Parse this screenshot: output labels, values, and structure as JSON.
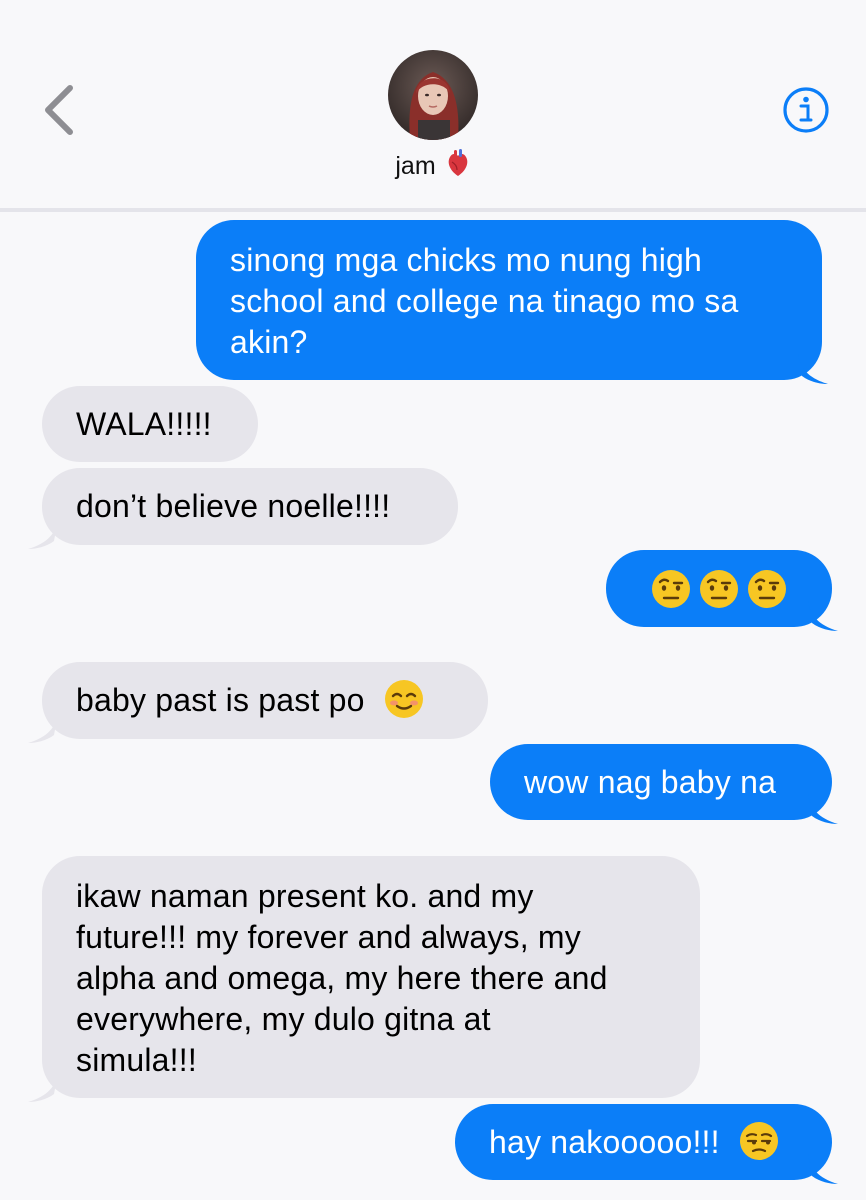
{
  "header": {
    "back_icon": "chevron-left-icon",
    "contact_name": "jam",
    "contact_emoji": "anatomical-heart",
    "info_icon": "info-icon"
  },
  "colors": {
    "sent_bubble": "#0b7ef8",
    "received_bubble": "#e6e5eb",
    "accent": "#0b7ef8",
    "background": "#f8f8fa"
  },
  "messages": [
    {
      "direction": "sent",
      "text": "sinong mga chicks mo nung high\nschool and college na tinago mo sa\nakin?"
    },
    {
      "direction": "received",
      "text": "WALA!!!!!"
    },
    {
      "direction": "received",
      "text": "don’t believe noelle!!!!"
    },
    {
      "direction": "sent",
      "text": "",
      "emojis": [
        "face-with-raised-eyebrow",
        "face-with-raised-eyebrow",
        "face-with-raised-eyebrow"
      ]
    },
    {
      "direction": "received",
      "text": "baby past is past po",
      "emojis": [
        "smiling-face"
      ]
    },
    {
      "direction": "sent",
      "text": "wow nag baby na"
    },
    {
      "direction": "received",
      "text": "ikaw naman present ko. and my\nfuture!!! my forever and always, my\nalpha and omega, my here there and\neverywhere, my dulo gitna at\nsimula!!!"
    },
    {
      "direction": "sent",
      "text": "hay nakooooo!!!",
      "emojis": [
        "unamused-face"
      ]
    }
  ]
}
